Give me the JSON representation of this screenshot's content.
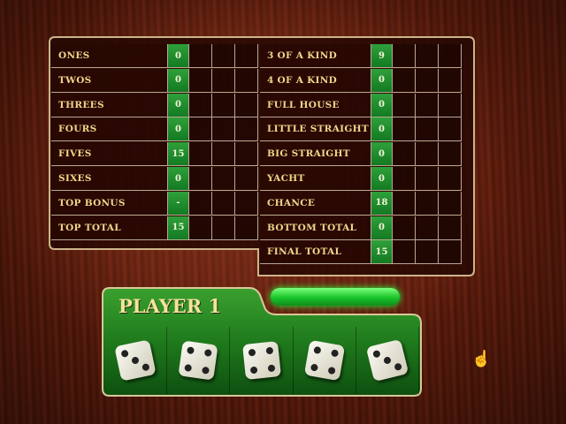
{
  "left_rows": [
    {
      "label": "ONES",
      "value": "0"
    },
    {
      "label": "TWOS",
      "value": "0"
    },
    {
      "label": "THREES",
      "value": "0"
    },
    {
      "label": "FOURS",
      "value": "0"
    },
    {
      "label": "FIVES",
      "value": "15"
    },
    {
      "label": "SIXES",
      "value": "0"
    },
    {
      "label": "TOP BONUS",
      "value": "-"
    },
    {
      "label": "TOP TOTAL",
      "value": "15"
    }
  ],
  "right_rows": [
    {
      "label": "3 OF A KIND",
      "value": "9"
    },
    {
      "label": "4 OF A KIND",
      "value": "0"
    },
    {
      "label": "FULL HOUSE",
      "value": "0"
    },
    {
      "label": "LITTLE STRAIGHT",
      "value": "0"
    },
    {
      "label": "BIG STRAIGHT",
      "value": "0"
    },
    {
      "label": "YACHT",
      "value": "0"
    },
    {
      "label": "CHANCE",
      "value": "18"
    },
    {
      "label": "BOTTOM TOTAL",
      "value": "0"
    },
    {
      "label": "FINAL TOTAL",
      "value": "15"
    }
  ],
  "player": {
    "name": "PLAYER 1"
  },
  "dice": [
    3,
    4,
    4,
    4,
    3
  ],
  "colors": {
    "accent_green": "#26c43a",
    "label_gold": "#f0d58a",
    "board_border": "#c9b28a"
  }
}
